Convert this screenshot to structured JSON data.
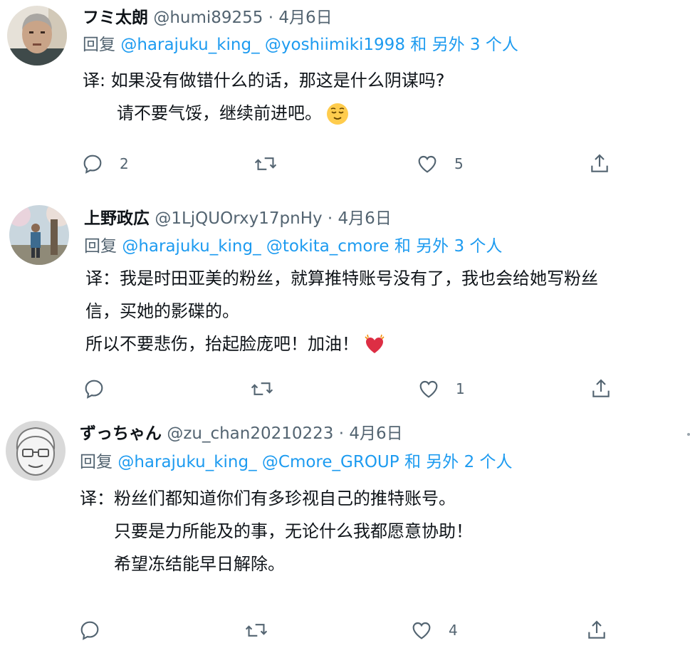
{
  "tweets": [
    {
      "name": "フミ太朗",
      "handle": "@humi89255",
      "dot": "·",
      "date": "4月6日",
      "reply_prefix": "回复",
      "mention1": "@harajuku_king_",
      "mention2": "@yoshiimiki1998",
      "and_others": "和 另外 3 个人",
      "lines": [
        "译: 如果没有做错什么的话，那这是什么阴谋吗?",
        "请不要气馁，继续前进吧。"
      ],
      "emoji_icon": "relieved-face-icon",
      "reply_count": "2",
      "retweet_count": "",
      "like_count": "5"
    },
    {
      "name": "上野政広",
      "handle": "@1LjQUOrxy17pnHy",
      "dot": "·",
      "date": "4月6日",
      "reply_prefix": "回复",
      "mention1": "@harajuku_king_",
      "mention2": "@tokita_cmore",
      "and_others": "和 另外 3 个人",
      "lines": [
        "译：我是时田亚美的粉丝，就算推特账号没有了，我也会给她写粉丝",
        "信，买她的影碟的。",
        "所以不要悲伤，抬起脸庞吧！加油！"
      ],
      "emoji_icon": "beating-heart-icon",
      "reply_count": "",
      "retweet_count": "",
      "like_count": "1"
    },
    {
      "name": "ずっちゃん",
      "handle": "@zu_chan20210223",
      "dot": "·",
      "date": "4月6日",
      "reply_prefix": "回复",
      "mention1": "@harajuku_king_",
      "mention2": "@Cmore_GROUP",
      "and_others": "和 另外 2 个人",
      "lines": [
        "译：粉丝们都知道你们有多珍视自己的推特账号。",
        "只要是力所能及的事，无论什么我都愿意协助！",
        "希望冻结能早日解除。"
      ],
      "emoji_icon": "",
      "reply_count": "",
      "retweet_count": "",
      "like_count": "4"
    }
  ],
  "colors": {
    "mention": "#1d9bf0",
    "secondary_text": "#536471",
    "primary_text": "#0f1419"
  },
  "icons": [
    "reply-icon",
    "retweet-icon",
    "like-icon",
    "share-icon"
  ]
}
